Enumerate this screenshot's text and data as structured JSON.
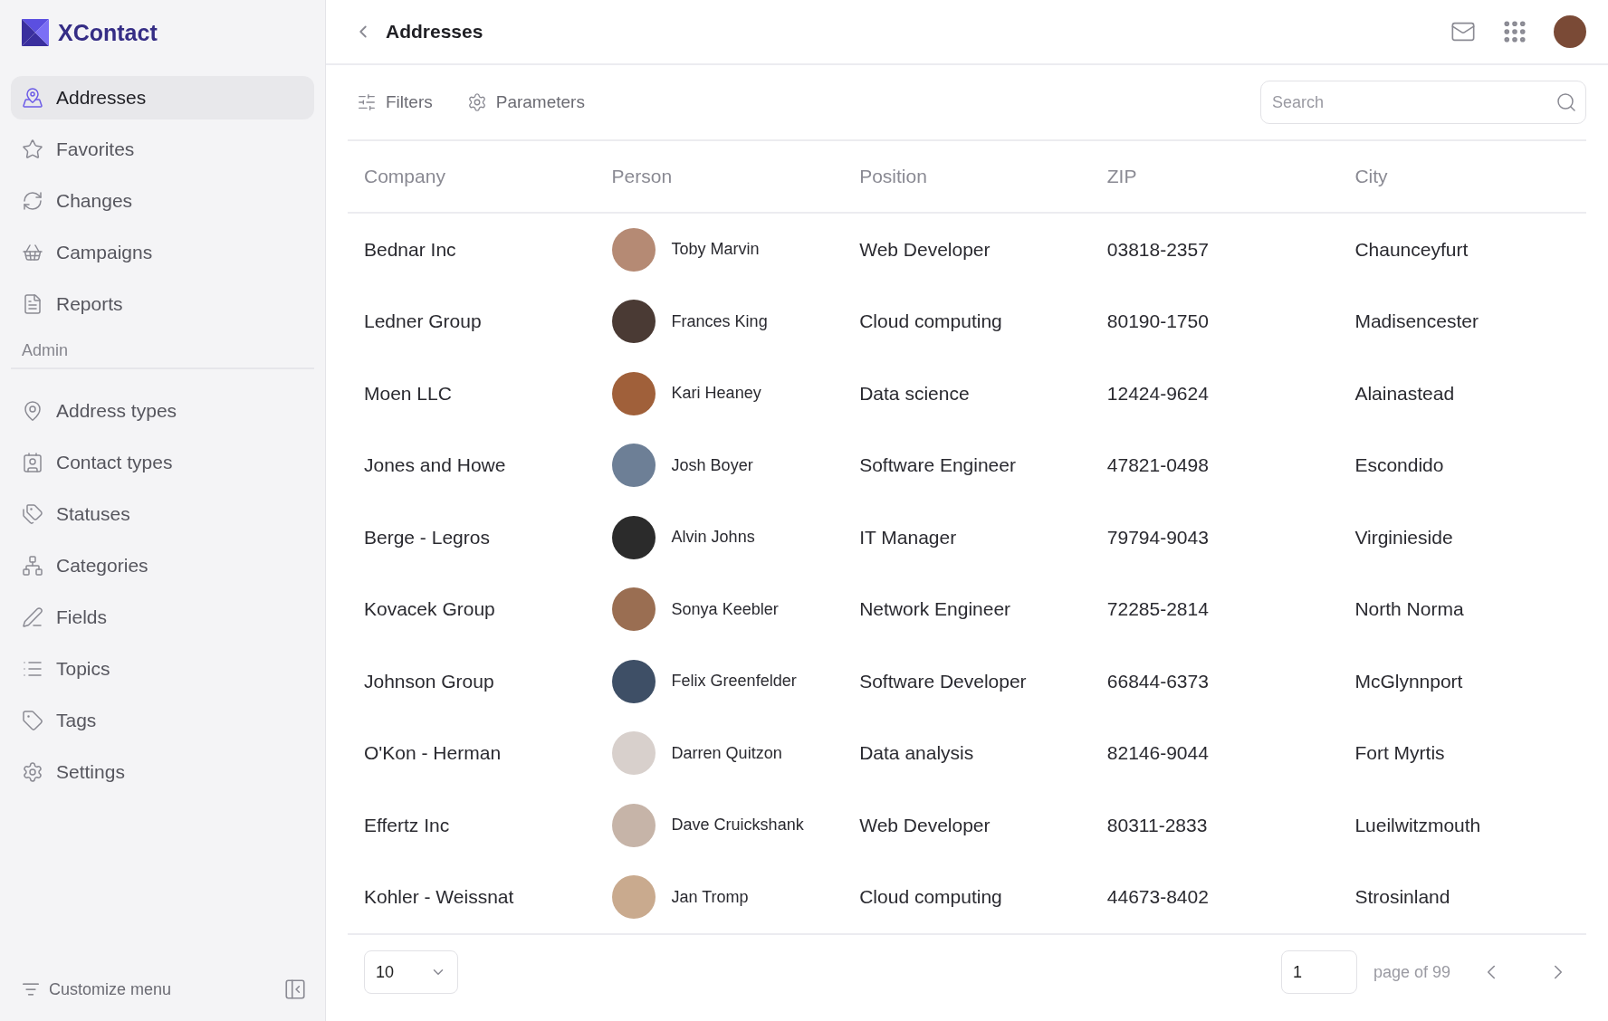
{
  "brand": {
    "name": "XContact"
  },
  "nav": [
    {
      "label": "Addresses",
      "selected": true
    },
    {
      "label": "Favorites",
      "selected": false
    },
    {
      "label": "Changes",
      "selected": false
    },
    {
      "label": "Campaigns",
      "selected": false
    },
    {
      "label": "Reports",
      "selected": false
    }
  ],
  "admin": {
    "title": "Admin",
    "items": [
      {
        "label": "Address types",
        "selected": false
      },
      {
        "label": "Contact types",
        "selected": false
      },
      {
        "label": "Statuses",
        "selected": false
      },
      {
        "label": "Categories",
        "selected": false
      },
      {
        "label": "Fields",
        "selected": false
      },
      {
        "label": "Topics",
        "selected": false
      },
      {
        "label": "Tags",
        "selected": false
      },
      {
        "label": "Settings",
        "selected": false
      }
    ]
  },
  "customize_menu": "Customize menu",
  "header": {
    "title": "Addresses"
  },
  "toolbar": [
    {
      "label": "Filters"
    },
    {
      "label": "Parameters"
    }
  ],
  "search": {
    "placeholder": "Search"
  },
  "table": {
    "columns": [
      "Company",
      "Person",
      "Position",
      "ZIP",
      "City"
    ],
    "rows": [
      {
        "company": "Bednar Inc",
        "person": "Toby Marvin",
        "position": "Web Developer",
        "zip": "03818-2357",
        "city": "Chaunceyfurt"
      },
      {
        "company": "Ledner Group",
        "person": "Frances King",
        "position": "Cloud computing",
        "zip": "80190-1750",
        "city": "Madisencester"
      },
      {
        "company": "Moen LLC",
        "person": "Kari Heaney",
        "position": "Data science",
        "zip": "12424-9624",
        "city": "Alainastead"
      },
      {
        "company": "Jones and Howe",
        "person": "Josh Boyer",
        "position": "Software Engineer",
        "zip": "47821-0498",
        "city": "Escondido"
      },
      {
        "company": "Berge - Legros",
        "person": "Alvin Johns",
        "position": "IT Manager",
        "zip": "79794-9043",
        "city": "Virginieside"
      },
      {
        "company": "Kovacek Group",
        "person": "Sonya Keebler",
        "position": "Network Engineer",
        "zip": "72285-2814",
        "city": "North Norma"
      },
      {
        "company": "Johnson Group",
        "person": "Felix Greenfelder",
        "position": "Software Developer",
        "zip": "66844-6373",
        "city": "McGlynnport"
      },
      {
        "company": "O'Kon - Herman",
        "person": "Darren Quitzon",
        "position": "Data analysis",
        "zip": "82146-9044",
        "city": "Fort Myrtis"
      },
      {
        "company": "Effertz Inc",
        "person": "Dave Cruickshank",
        "position": "Web Developer",
        "zip": "80311-2833",
        "city": "Lueilwitzmouth"
      },
      {
        "company": "Kohler - Weissnat",
        "person": "Jan Tromp",
        "position": "Cloud computing",
        "zip": "44673-8402",
        "city": "Strosinland"
      }
    ]
  },
  "pagination": {
    "page_size": "10",
    "page": "1",
    "page_label": "page of 99"
  }
}
